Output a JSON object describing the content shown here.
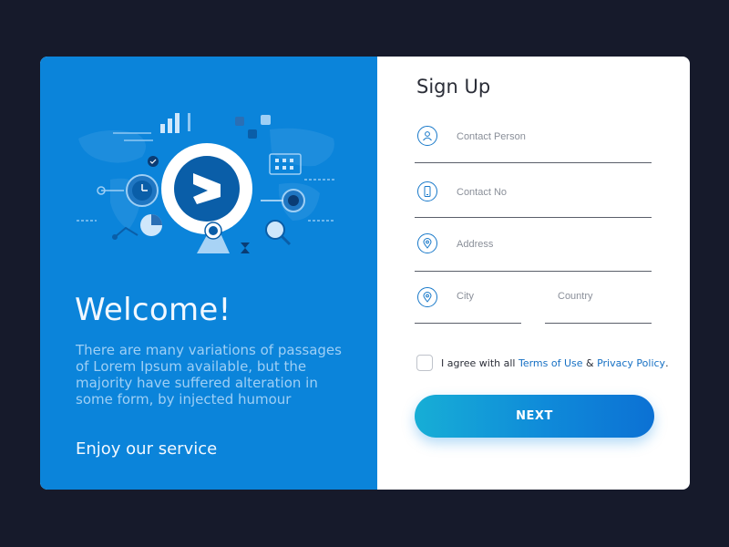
{
  "left": {
    "welcome": "Welcome!",
    "description": "There are many variations of passages of Lorem Ipsum available, but the majority have suffered alteration in some form, by injected humour",
    "enjoy": "Enjoy our service"
  },
  "form": {
    "title": "Sign Up",
    "contact_person": {
      "placeholder": "Contact Person",
      "icon": "user-icon"
    },
    "contact_no": {
      "placeholder": "Contact No",
      "icon": "phone-icon"
    },
    "address": {
      "placeholder": "Address",
      "icon": "location-pin-icon"
    },
    "city": {
      "placeholder": "City",
      "icon": "location-pin-icon"
    },
    "country": {
      "placeholder": "Country"
    },
    "agree": {
      "prefix": "I agree with all",
      "terms": "Terms of Use",
      "and": "&",
      "privacy": "Privacy Policy",
      "suffix": "."
    },
    "next_label": "NEXT"
  },
  "colors": {
    "background": "#161a2b",
    "left_panel": "#0b84da",
    "accent": "#1670c4",
    "button_start": "#17aed6",
    "button_end": "#0c71d4"
  }
}
